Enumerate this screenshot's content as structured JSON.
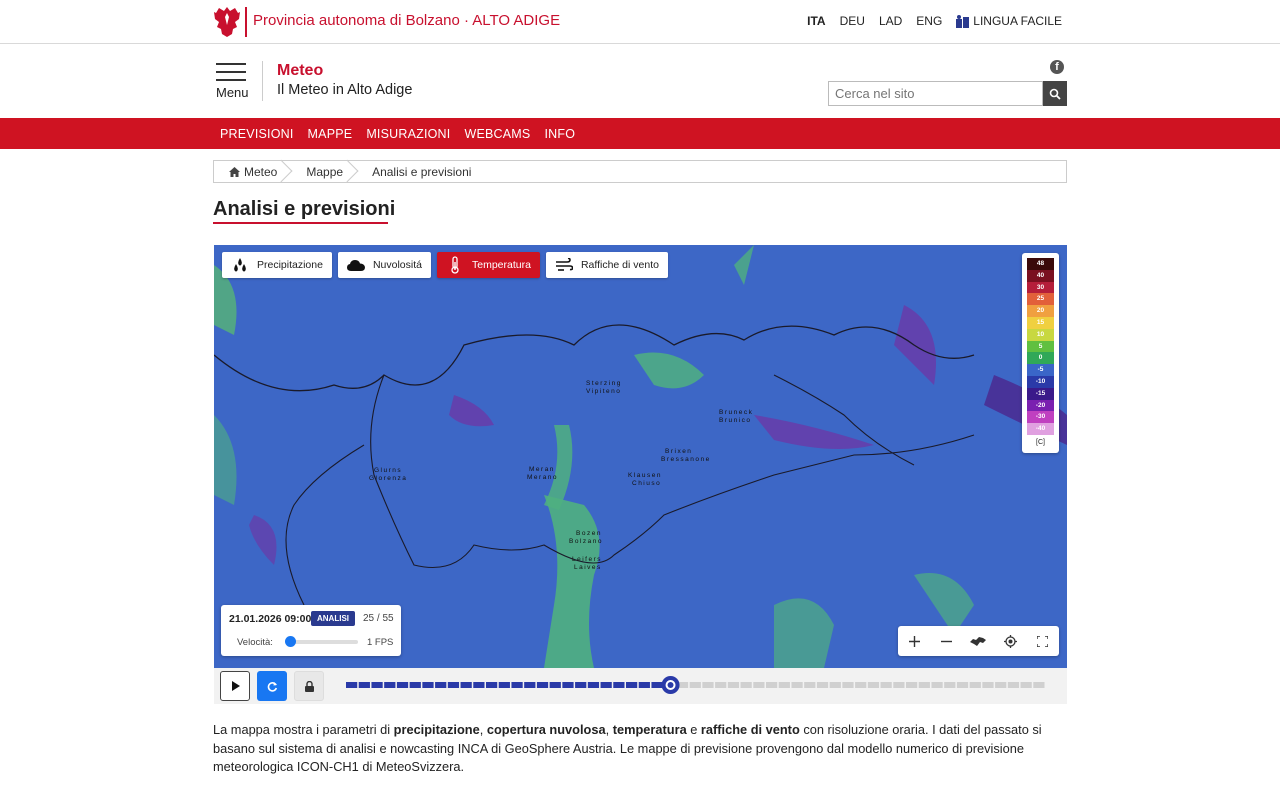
{
  "topbar": {
    "site_name": "Provincia autonoma di Bolzano · ALTO ADIGE",
    "languages": [
      "ITA",
      "DEU",
      "LAD",
      "ENG"
    ],
    "active_language": "ITA",
    "lingua_facile": "LINGUA FACILE"
  },
  "header": {
    "menu_label": "Menu",
    "title": "Meteo",
    "subtitle": "Il Meteo in Alto Adige",
    "search_placeholder": "Cerca nel sito"
  },
  "nav": {
    "items": [
      "PREVISIONI",
      "MAPPE",
      "MISURAZIONI",
      "WEBCAMS",
      "INFO"
    ]
  },
  "breadcrumb": [
    "Meteo",
    "Mappe",
    "Analisi e previsioni"
  ],
  "page_title": "Analisi e previsioni",
  "map": {
    "layers": [
      {
        "label": "Precipitazione",
        "icon": "drops-icon",
        "active": false
      },
      {
        "label": "Nuvolositá",
        "icon": "cloud-icon",
        "active": false
      },
      {
        "label": "Temperatura",
        "icon": "thermometer-icon",
        "active": true
      },
      {
        "label": "Raffiche di vento",
        "icon": "wind-icon",
        "active": false
      }
    ],
    "legend": {
      "values": [
        "48",
        "40",
        "30",
        "25",
        "20",
        "15",
        "10",
        "5",
        "0",
        "-5",
        "-10",
        "-15",
        "-20",
        "-30",
        "-40"
      ],
      "colors": [
        "#3a0a0a",
        "#7a1020",
        "#b51e3a",
        "#e2603a",
        "#f0a040",
        "#f0d040",
        "#c8d840",
        "#60c040",
        "#30a858",
        "#3a66c8",
        "#2a3aa8",
        "#3a1a8a",
        "#7a20b0",
        "#c040c0",
        "#e0a0e0"
      ],
      "unit": "[C]"
    },
    "places": [
      {
        "name": "Sterzing\nVipiteno"
      },
      {
        "name": "Bruneck\nBrunico"
      },
      {
        "name": "Brixen\nBressanone"
      },
      {
        "name": "Glurns\nGlorenza"
      },
      {
        "name": "Meran\nMerano"
      },
      {
        "name": "Klausen\nChiuso"
      },
      {
        "name": "Bozen\nBolzano"
      },
      {
        "name": "Leifers\nLaives"
      }
    ],
    "time_panel": {
      "datetime": "21.01.2026 09:00",
      "badge": "ANALISI",
      "frame": "25 / 55",
      "speed_label": "Velocità:",
      "fps": "1 FPS",
      "speed_value": 0
    },
    "tools": [
      "zoom-in-icon",
      "zoom-out-icon",
      "region-icon",
      "locate-icon",
      "fullscreen-icon"
    ]
  },
  "player": {
    "current_frame": 25,
    "total_frames": 55
  },
  "description": {
    "p1": "La mappa mostra i parametri di ",
    "b1": "precipitazione",
    "s1": ", ",
    "b2": "copertura nuvolosa",
    "s2": ", ",
    "b3": "temperatura",
    "s3": " e ",
    "b4": "raffiche di vento",
    "p2": " con risoluzione oraria. I dati del passato si basano sul sistema di analisi e nowcasting INCA di GeoSphere Austria. Le mappe di previsione provengono dal modello numerico di previsione meteorologica ICON-CH1 di MeteoSvizzera."
  }
}
